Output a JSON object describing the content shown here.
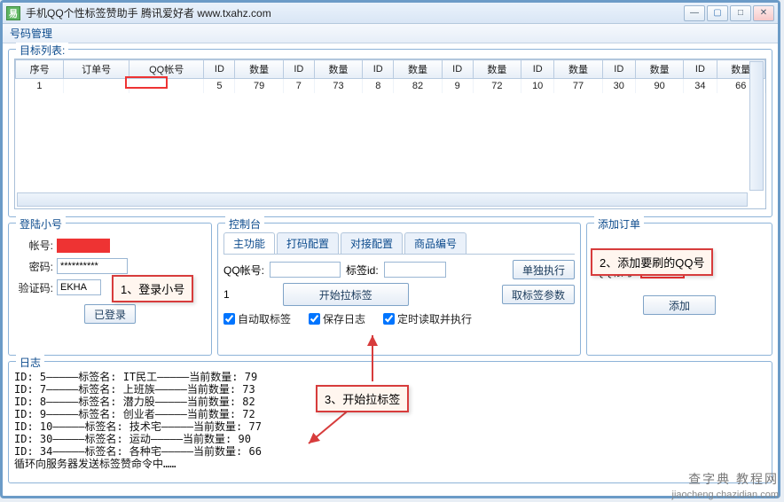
{
  "window": {
    "title": "手机QQ个性标签赞助手 腾讯爱好者 www.txahz.com"
  },
  "menu": {
    "item1": "号码管理"
  },
  "target": {
    "legend": "目标列表:",
    "headers": [
      "序号",
      "订单号",
      "QQ帐号",
      "ID",
      "数量",
      "ID",
      "数量",
      "ID",
      "数量",
      "ID",
      "数量",
      "ID",
      "数量",
      "ID",
      "数量",
      "ID",
      "数量"
    ],
    "row": [
      "1",
      "",
      "",
      "5",
      "79",
      "7",
      "73",
      "8",
      "82",
      "9",
      "72",
      "10",
      "77",
      "30",
      "90",
      "34",
      "66"
    ]
  },
  "login": {
    "legend": "登陆小号",
    "acct_label": "帐号:",
    "pwd_label": "密码:",
    "pwd_value": "**********",
    "captcha_label": "验证码:",
    "captcha_value": "EKHA",
    "logged_btn": "已登录"
  },
  "console": {
    "legend": "控制台",
    "tabs": [
      "主功能",
      "打码配置",
      "对接配置",
      "商品编号"
    ],
    "qq_label": "QQ帐号:",
    "tag_label": "标签id:",
    "count_prefix": "1",
    "exec_btn": "单独执行",
    "start_btn": "开始拉标签",
    "fetch_btn": "取标签参数",
    "chk_auto": "自动取标签",
    "chk_savelog": "保存日志",
    "chk_timed": "定时读取并执行"
  },
  "add": {
    "legend": "添加订单",
    "qq_label": "QQ帐号:",
    "add_btn": "添加"
  },
  "log": {
    "legend": "日志",
    "text": "ID: 5—————标签名: IT民工—————当前数量: 79\nID: 7—————标签名: 上班族—————当前数量: 73\nID: 8—————标签名: 潜力股—————当前数量: 82\nID: 9—————标签名: 创业者—————当前数量: 72\nID: 10—————标签名: 技术宅—————当前数量: 77\nID: 30—————标签名: 运动—————当前数量: 90\nID: 34—————标签名: 各种宅—————当前数量: 66\n循环向服务器发送标签赞命令中……"
  },
  "callouts": {
    "c1": "1、登录小号",
    "c2": "2、添加要刷的QQ号",
    "c3": "3、开始拉标签"
  },
  "footer": {
    "wm1": "查字典 教程网",
    "wm2": "jiaocheng.chazidian.com"
  }
}
